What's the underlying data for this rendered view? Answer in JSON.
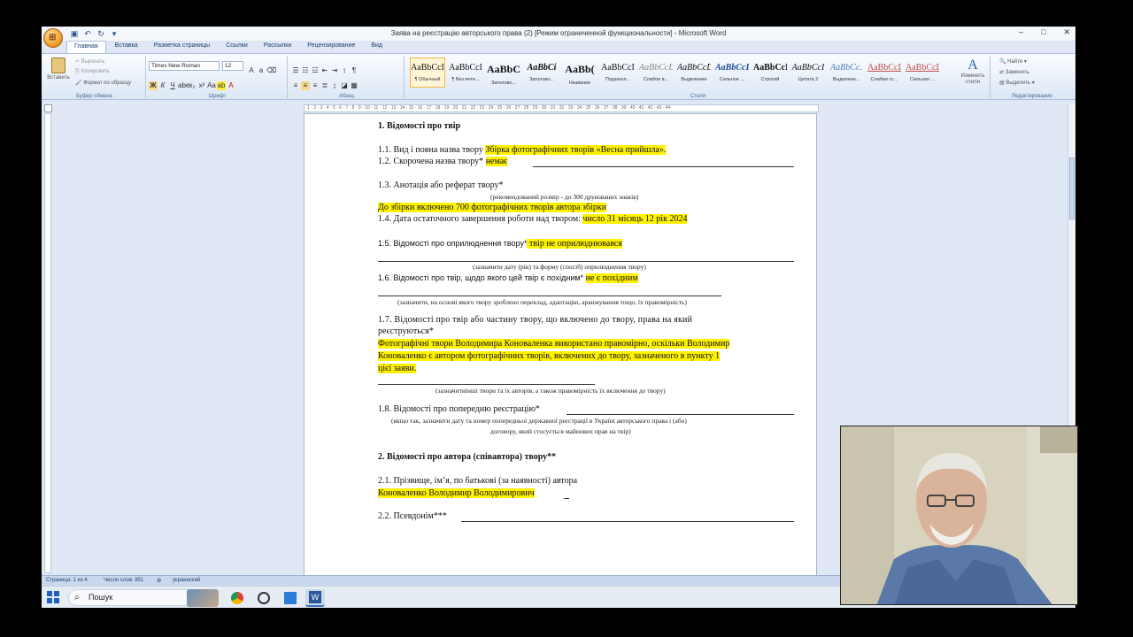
{
  "window": {
    "title": "Заява на реєстрацію авторського права (2) [Режим ограниченной функциональности] - Microsoft Word"
  },
  "tabs": [
    "Главная",
    "Вставка",
    "Разметка страницы",
    "Ссылки",
    "Рассылки",
    "Рецензирование",
    "Вид"
  ],
  "ribbon": {
    "clipboard": {
      "paste": "Вставить",
      "cut": "Вырезать",
      "copy": "Копировать",
      "format_painter": "Формат по образцу",
      "label": "Буфер обмена"
    },
    "font": {
      "name": "Times New Roman",
      "size": "12",
      "label": "Шрифт"
    },
    "paragraph": {
      "label": "Абзац"
    },
    "styles": {
      "label": "Стили",
      "items": [
        {
          "sample": "AaBbCcI",
          "name": "¶ Обычный"
        },
        {
          "sample": "AaBbCcI",
          "name": "¶ Без инте..."
        },
        {
          "sample": "AaBbC",
          "name": "Заголово..."
        },
        {
          "sample": "AaBbCi",
          "name": "Заголово..."
        },
        {
          "sample": "AaBb(",
          "name": "Название"
        },
        {
          "sample": "AaBbCcI",
          "name": "Подзагол..."
        },
        {
          "sample": "AaBbCcD",
          "name": "Слабое в..."
        },
        {
          "sample": "AaBbCcD",
          "name": "Выделение"
        },
        {
          "sample": "AaBbCcD",
          "name": "Сильное ..."
        },
        {
          "sample": "AaBbCcD",
          "name": "Строгий"
        },
        {
          "sample": "AaBbCcI",
          "name": "Цитата 2"
        },
        {
          "sample": "AaBbCc.",
          "name": "Выделенн..."
        },
        {
          "sample": "AaBbCcD",
          "name": "Слабая сс..."
        },
        {
          "sample": "AaBbCcD",
          "name": "Сильная ..."
        }
      ],
      "change": "Изменить стили"
    },
    "editing": {
      "find": "Найти",
      "replace": "Заменить",
      "select": "Выделить",
      "label": "Редактирование"
    }
  },
  "document": {
    "h1": "1. Відомості про твір",
    "l11_pre": "1.1. Вид і повна назва твору ",
    "l11_hl": "Збірка фотографічних творів «Весна прийшла».",
    "l12_pre": "1.2. Скорочена назва твору* ",
    "l12_hl": "немає",
    "l13": "1.3. Анотація або реферат твору*",
    "l13_note": "(рекомендований розмір - до 300 друкованих знаків)",
    "l13_hl": "До збірки включено 700 фотографічних творів автора збірки",
    "l14_pre": "1.4. Дата остаточного завершення роботи над твором: ",
    "l14_hl": "число 31 місяць 12 рік 2024",
    "l15_pre": "1.5. Відомості про оприлюднення твору*",
    "l15_hl": " твір не оприлюднювався",
    "l15_note": "(зазначити  дату (рік) та форму (спосіб) оприлюднення твору)",
    "l16_pre": "1.6. Відомості про твір, щодо якого цей твір є похідним* ",
    "l16_hl": "не є похідним",
    "l16_note": "(зазначити, на основі якого твору зроблено переклад, адаптацію, аранжування тощо, їх правомірність)",
    "l17_a": "1.7.  Відомості  про  твір  або  частину  твору,  що  включено  до  твору,  права  на  який",
    "l17_b": "реєструються*",
    "l17_hl1": "Фотографічні твори Володимира Коноваленка використано правомірно, оскільки Володимир",
    "l17_hl2": "Коноваленко є автором фотографічних творів, включених до твору, зазначеного в пункту 1",
    "l17_hl3": "цієї заяви.",
    "l17_note": "(зазначитиінші твори та їх авторів, а також правомірність їх включення до твору)",
    "l18_pre": "1.8. Відомості про попередню реєстрацію*",
    "l18_note1": "(якщо так, зазначити  дату та номер попередньої державної реєстрації в Україні авторського права і (або)",
    "l18_note2": "договору, який стосується майнових прав на твір)",
    "h2": "2. Відомості про автора (співавтора) твору**",
    "l21": "2.1. Прізвище, ім’я, по батькові (за наявності) автора",
    "l21_hl": "Коноваленко Володимир Володимирович",
    "l21_tail": " ",
    "l22": "2.2. Псевдонім***"
  },
  "status": {
    "page": "Страница: 1 из 4",
    "words": "Число слов: 851",
    "lang": "украинский"
  },
  "taskbar": {
    "search": "Пошук"
  }
}
